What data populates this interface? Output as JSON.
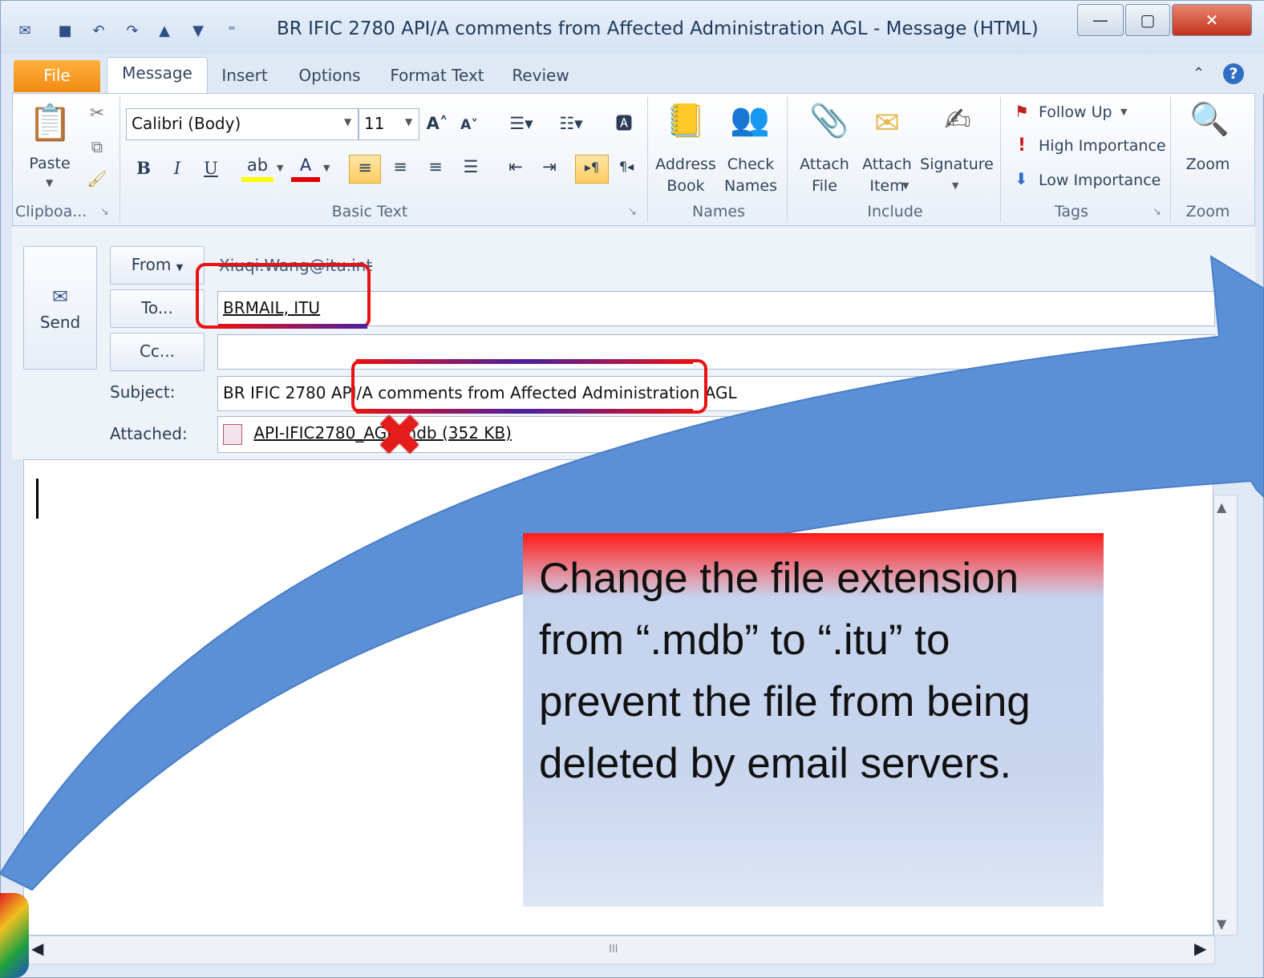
{
  "window": {
    "title": "BR IFIC 2780 API/A comments from Affected Administration AGL  -  Message (HTML)"
  },
  "tabs": [
    {
      "label": "File"
    },
    {
      "label": "Message"
    },
    {
      "label": "Insert"
    },
    {
      "label": "Options"
    },
    {
      "label": "Format Text"
    },
    {
      "label": "Review"
    }
  ],
  "ribbon": {
    "clipboard": {
      "paste": "Paste",
      "group": "Clipboa..."
    },
    "basic_text": {
      "font": "Calibri (Body)",
      "size": "11",
      "group": "Basic Text",
      "bold": "B",
      "italic": "I",
      "underline": "U"
    },
    "names": {
      "address_book": "Address\nBook",
      "check_names": "Check\nNames",
      "group": "Names"
    },
    "include": {
      "attach_file": "Attach\nFile",
      "attach_item": "Attach\nItem",
      "signature": "Signature",
      "group": "Include"
    },
    "tags": {
      "follow_up": "Follow Up",
      "high": "High Importance",
      "low": "Low Importance",
      "group": "Tags"
    },
    "zoom": {
      "label": "Zoom",
      "group": "Zoom"
    }
  },
  "header": {
    "send": "Send",
    "from_button": "From",
    "from_value": "Xiuqi.Wang@itu.int",
    "to_button": "To...",
    "to_value": "BRMAIL, ITU",
    "cc_button": "Cc...",
    "cc_value": "",
    "subject_label": "Subject:",
    "subject_value": "BR IFIC 2780 API/A comments from Affected Administration AGL",
    "attached_label": "Attached:",
    "attachment_name": "API-IFIC2780_AGL.mdb",
    "attachment_size": "(352 KB)"
  },
  "callout": {
    "text": "Change the file extension from “.mdb” to “.itu” to prevent the file from being deleted by email servers."
  },
  "scroll": {
    "hscroll_mark": "III"
  },
  "colors": {
    "file_tab": "#f38a13",
    "highlight": "#e81212",
    "arrow": "#5588cc"
  }
}
